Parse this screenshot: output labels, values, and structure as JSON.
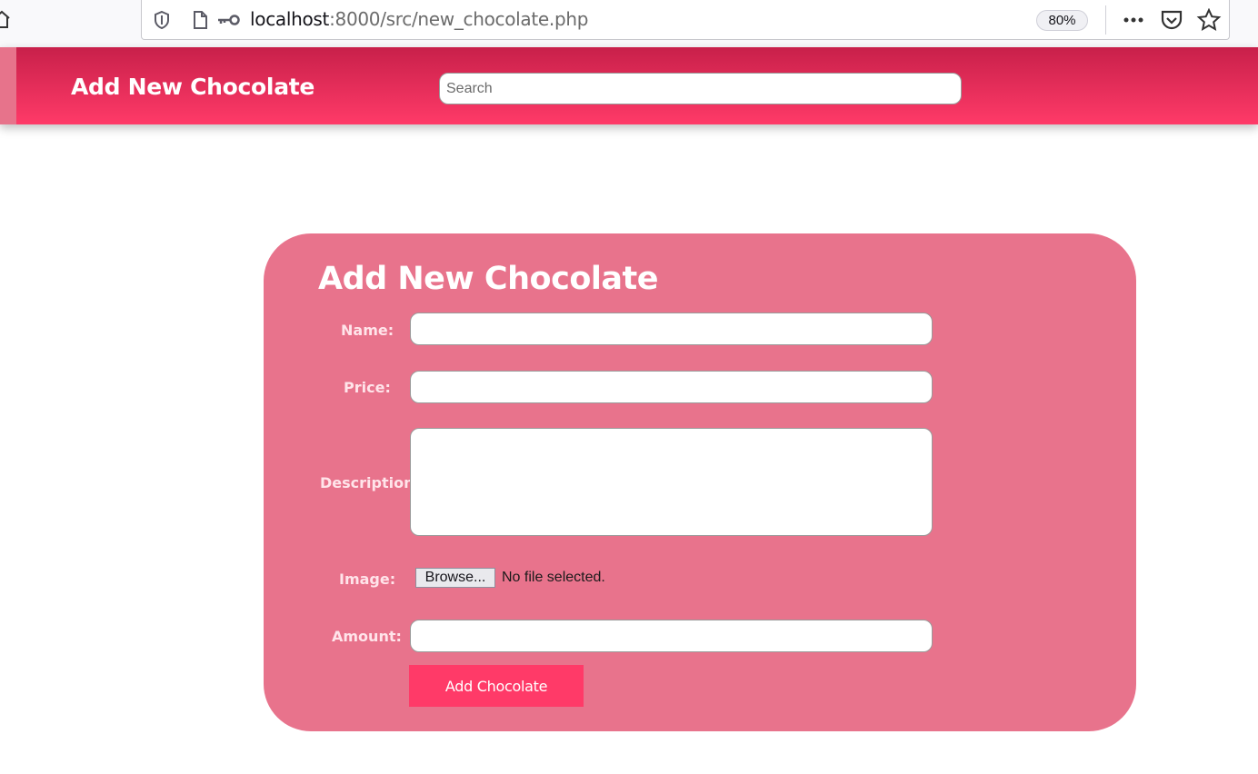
{
  "browser": {
    "url_host": "localhost",
    "url_path": ":8000/src/new_chocolate.php",
    "zoom": "80%",
    "icons": [
      "home-icon",
      "shield-icon",
      "page-icon",
      "key-icon",
      "more-icon",
      "pocket-icon",
      "star-icon"
    ]
  },
  "header": {
    "title": "Add New Chocolate",
    "search_placeholder": "Search"
  },
  "form": {
    "title": "Add New Chocolate",
    "name_label": "Name:",
    "price_label": "Price:",
    "description_label": "Description:",
    "image_label": "Image:",
    "amount_label": "Amount:",
    "browse_label": "Browse...",
    "file_status": "No file selected.",
    "submit_label": "Add Chocolate"
  },
  "colors": {
    "header_top": "#c8204a",
    "header_bottom": "#ff3a68",
    "card": "#e8738c",
    "button": "#ff3a68"
  }
}
